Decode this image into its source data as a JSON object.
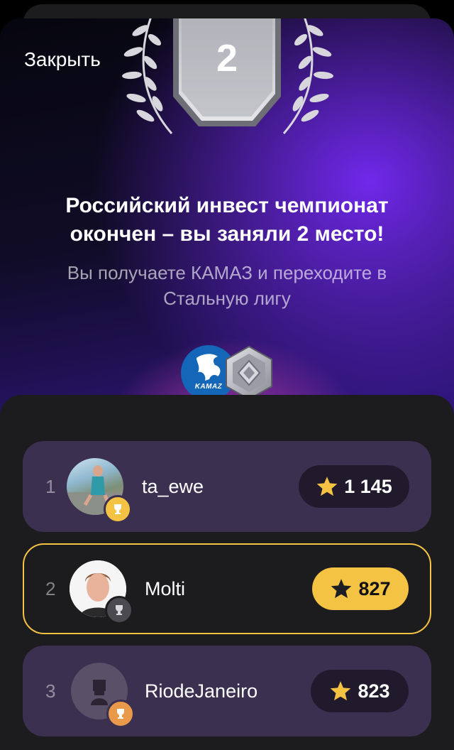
{
  "header": {
    "close_label": "Закрыть"
  },
  "result": {
    "place": "2",
    "title": "Российский инвест чемпионат окончен – вы заняли 2 место!",
    "subtitle": "Вы получаете КАМАЗ и переходите в Стальную лигу"
  },
  "reward": {
    "company_logo_text": "KAMAZ",
    "company_icon": "kamaz-logo",
    "league_icon": "steel-league-badge"
  },
  "colors": {
    "accent": "#f5c343",
    "row_bg": "#3c3051",
    "panel_bg": "#1c1c1e",
    "purple": "#7028eb"
  },
  "leaderboard": [
    {
      "rank": "1",
      "username": "ta_ewe",
      "score": "1 145",
      "trophy": "gold",
      "current": false
    },
    {
      "rank": "2",
      "username": "Molti",
      "score": "827",
      "trophy": "silver",
      "current": true
    },
    {
      "rank": "3",
      "username": "RiodeJaneiro",
      "score": "823",
      "trophy": "bronze",
      "current": false
    }
  ]
}
